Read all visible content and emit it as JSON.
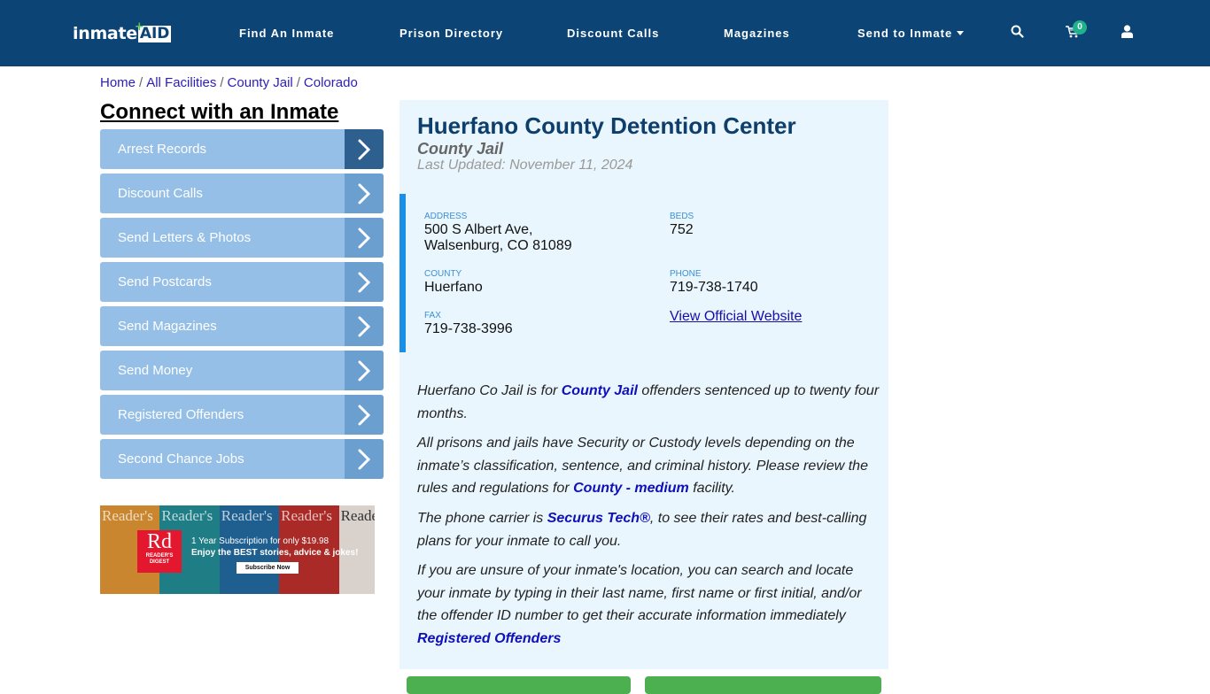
{
  "navbar": {
    "logo_text_primary": "inmate",
    "logo_text_accent": "AID",
    "logo_plus": "+",
    "items": [
      {
        "label": "Find An Inmate"
      },
      {
        "label": "Prison Directory"
      },
      {
        "label": "Discount Calls"
      },
      {
        "label": "Magazines"
      },
      {
        "label": "Send to Inmate"
      }
    ],
    "icons": {
      "search": "search-icon",
      "cart": "cart-icon",
      "user": "user-icon"
    },
    "cart_count": "0",
    "colors": {
      "background": "#0b4475",
      "badge": "#20b28a"
    }
  },
  "breadcrumb": {
    "items": [
      {
        "label": "Home"
      },
      {
        "label": "All Facilities"
      },
      {
        "label": "County Jail"
      },
      {
        "label": "Colorado"
      }
    ],
    "separator": "/"
  },
  "sidebar": {
    "title": "Connect with an Inmate",
    "items": [
      {
        "label": "Arrest Records"
      },
      {
        "label": "Discount Calls"
      },
      {
        "label": "Send Letters & Photos"
      },
      {
        "label": "Send Postcards"
      },
      {
        "label": "Send Magazines"
      },
      {
        "label": "Send Money"
      },
      {
        "label": "Registered Offenders"
      },
      {
        "label": "Second Chance Jobs"
      }
    ],
    "ad": {
      "brand_logo": "Rd",
      "brand_name": "READER'S DIGEST",
      "cover_title": "Reader's",
      "line1": "1 Year Subscription for only $19.98",
      "line2": "Enjoy the BEST stories, advice & jokes!",
      "button": "Subscribe Now"
    }
  },
  "facility": {
    "name": "Huerfano County Detention Center",
    "type": "County Jail",
    "last_updated": "Last Updated: November 11, 2024",
    "info": {
      "address_label": "ADDRESS",
      "address_line1": "500 S Albert Ave,",
      "address_line2": "Walsenburg, CO 81089",
      "beds_label": "BEDS",
      "beds": "752",
      "county_label": "COUNTY",
      "county": "Huerfano",
      "phone_label": "PHONE",
      "phone": "719-738-1740",
      "fax_label": "FAX",
      "fax": "719-738-3996",
      "website_link": "View Official Website"
    },
    "description": {
      "p1_before": "Huerfano Co Jail is for ",
      "p1_link": "County Jail",
      "p1_after": " offenders sentenced up to twenty four months.",
      "p2_before": "All prisons and jails have Security or Custody levels depending on the inmate’s classification, sentence, and criminal history. Please review the rules and regulations for ",
      "p2_link": "County - medium",
      "p2_after": " facility.",
      "p3_before": "The phone carrier is ",
      "p3_link": "Securus Tech®",
      "p3_after": ", to see their rates and best-calling plans for your inmate to call you.",
      "p4_text": "If you are unsure of your inmate's location, you can search and locate your inmate by typing in their last name, first name or first initial, and/or the offender ID number to get their accurate information immediately",
      "p4_link": "Registered Offenders"
    }
  }
}
